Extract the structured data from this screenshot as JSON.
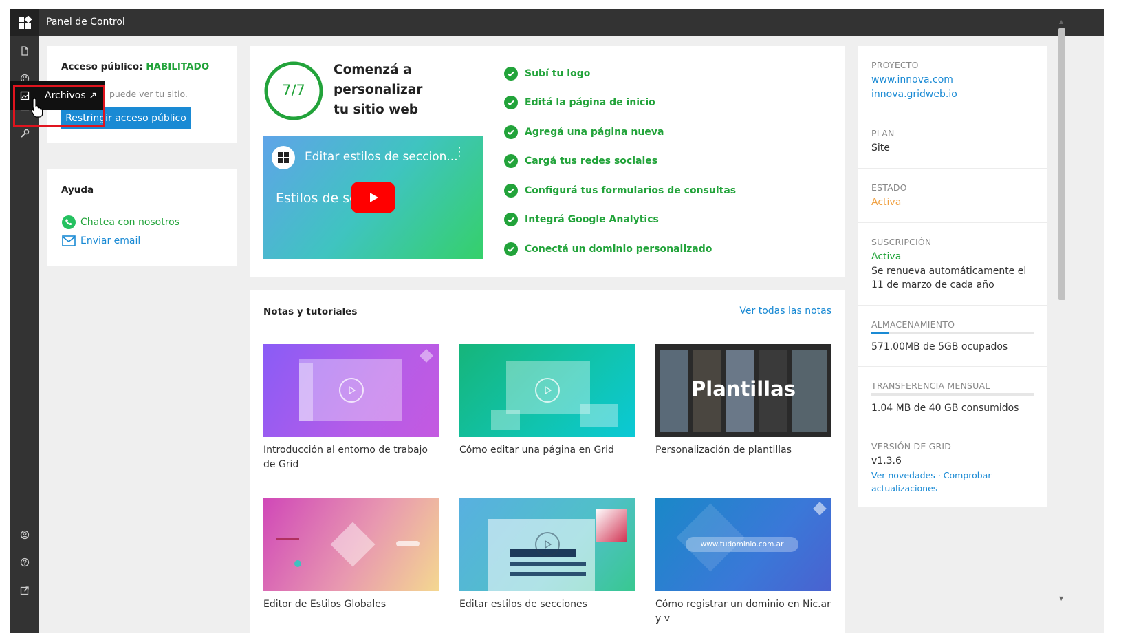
{
  "app": {
    "title": "Panel de Control"
  },
  "tooltip": {
    "label": "Archivos ↗"
  },
  "access": {
    "label": "Acceso público:",
    "status": "HABILITADO",
    "description": "puede ver tu sitio.",
    "button": "Restringir acceso público"
  },
  "help": {
    "title": "Ayuda",
    "whatsapp": "Chatea con nosotros",
    "email": "Enviar email"
  },
  "onboarding": {
    "progress": "7/7",
    "progress_fraction": 1.0,
    "title_l1": "Comenzá a",
    "title_l2": "personalizar",
    "title_l3": "tu sitio web",
    "video_title": "Editar estilos de seccion...",
    "video_overlay": "Estilos de se",
    "checklist": [
      "Subí tu logo",
      "Editá la página de inicio",
      "Agregá una página nueva",
      "Cargá tus redes sociales",
      "Configurá tus formularios de consultas",
      "Integrá Google Analytics",
      "Conectá un dominio personalizado"
    ]
  },
  "notes": {
    "title": "Notas y tutoriales",
    "view_all": "Ver todas las notas",
    "items": [
      {
        "caption": "Introducción al entorno de trabajo de Grid"
      },
      {
        "caption": "Cómo editar una página en Grid"
      },
      {
        "caption": "Personalización de plantillas",
        "thumb_text": "Plantillas"
      },
      {
        "caption": "Editor de Estilos Globales"
      },
      {
        "caption": "Editar estilos de secciones"
      },
      {
        "caption": "Cómo registrar un dominio en Nic.ar y v",
        "thumb_text": "www.tudominio.com.ar"
      }
    ]
  },
  "project": {
    "label": "PROYECTO",
    "domain1": "www.innova.com",
    "domain2": "innova.gridweb.io",
    "plan_label": "PLAN",
    "plan_value": "Site",
    "status_label": "ESTADO",
    "status_value": "Activa",
    "subscription_label": "SUSCRIPCIÓN",
    "subscription_status": "Activa",
    "subscription_note": "Se renueva automáticamente el 11 de marzo de cada año",
    "storage_label": "ALMACENAMIENTO",
    "storage_value": "571.00MB de 5GB ocupados",
    "storage_fraction": 0.11,
    "transfer_label": "TRANSFERENCIA MENSUAL",
    "transfer_value": "1.04 MB de 40 GB consumidos",
    "transfer_fraction": 0.0,
    "version_label": "VERSIÓN DE GRID",
    "version_value": "v1.3.6",
    "news_link": "Ver novedades",
    "separator": "·",
    "check_link": "Comprobar actualizaciones"
  },
  "colors": {
    "accent": "#1a8ad4",
    "success": "#22a33a",
    "warning": "#f0a040",
    "highlight": "#e0141e"
  }
}
